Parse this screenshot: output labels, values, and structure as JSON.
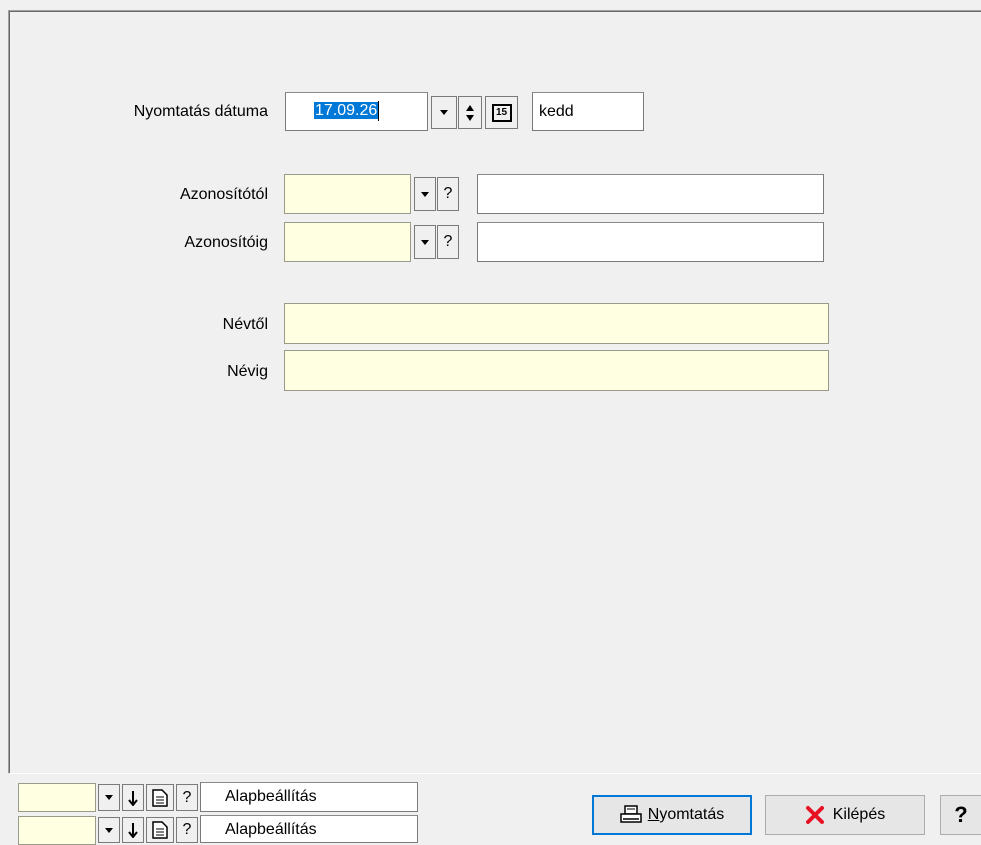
{
  "form": {
    "print_date_label": "Nyomtatás dátuma",
    "print_date_value": "17.09.26",
    "day_name": "kedd",
    "calendar_icon_text": "15",
    "id_from_label": "Azonosítótól",
    "id_to_label": "Azonosítóig",
    "name_from_label": "Névtől",
    "name_to_label": "Névig",
    "help_glyph": "?"
  },
  "footer": {
    "preset_rows": [
      {
        "preset_label": "Alapbeállítás"
      },
      {
        "preset_label": "Alapbeállítás"
      }
    ],
    "print_button_rest": "yomtatás",
    "print_button_mnemonic": "N",
    "exit_button_label": "Kilépés",
    "help_button_label": "?"
  },
  "colors": {
    "input_yellow": "#ffffe1",
    "selection_blue": "#0078d7",
    "exit_icon_red": "#e81123"
  }
}
